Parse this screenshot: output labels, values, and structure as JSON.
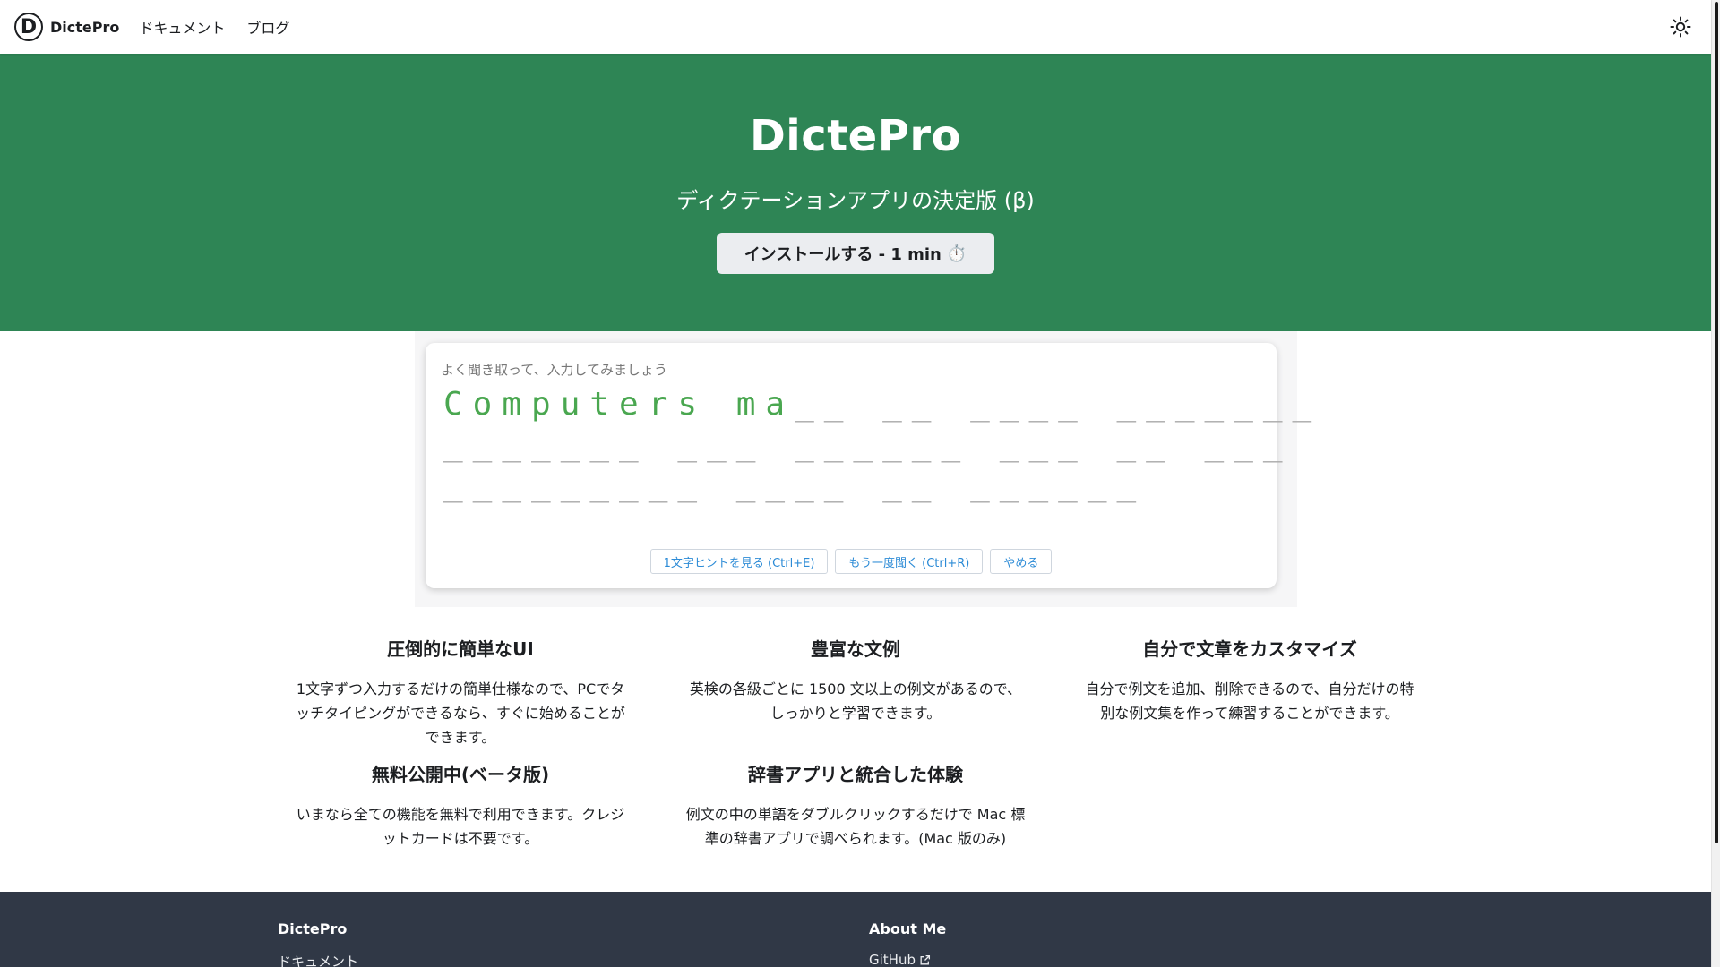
{
  "navbar": {
    "logo_letter": "D",
    "brand": "DictePro",
    "links": [
      "ドキュメント",
      "ブログ"
    ]
  },
  "hero": {
    "title": "DictePro",
    "subtitle": "ディクテーションアプリの決定版 (β)",
    "install_label": "インストールする - 1 min",
    "install_emoji": "⏱️"
  },
  "dictation": {
    "prompt": "よく聞き取って、入力してみましょう",
    "line1_typed": "Computers ma",
    "line1_blank": "__ __ ____ _______",
    "line2_blank": "_______ ___ ______ ___ __ ___",
    "line3_blank": "_________ ____ __ ______",
    "buttons": {
      "hint": "1文字ヒントを見る (Ctrl+E)",
      "replay": "もう一度聞く (Ctrl+R)",
      "quit": "やめる"
    }
  },
  "features": [
    {
      "title": "圧倒的に簡単なUI",
      "text": "1文字ずつ入力するだけの簡単仕様なので、PCでタッチタイピングができるなら、すぐに始めることができます。"
    },
    {
      "title": "豊富な文例",
      "text": "英検の各級ごとに 1500 文以上の例文があるので、しっかりと学習できます。"
    },
    {
      "title": "自分で文章をカスタマイズ",
      "text": "自分で例文を追加、削除できるので、自分だけの特別な例文集を作って練習することができます。"
    },
    {
      "title": "無料公開中(ベータ版)",
      "text": "いまなら全ての機能を無料で利用できます。クレジットカードは不要です。"
    },
    {
      "title": "辞書アプリと統合した体験",
      "text": "例文の中の単語をダブルクリックするだけで Mac 標準の辞書アプリで調べられます。(Mac 版のみ)"
    }
  ],
  "footer": {
    "col1": {
      "heading": "DictePro",
      "link": "ドキュメント"
    },
    "col2": {
      "heading": "About Me",
      "link": "GitHub"
    }
  },
  "colors": {
    "hero_green": "#2e8555",
    "typed_green": "#4aa750",
    "footer_bg": "#303846",
    "button_blue": "#2c8bd6"
  }
}
